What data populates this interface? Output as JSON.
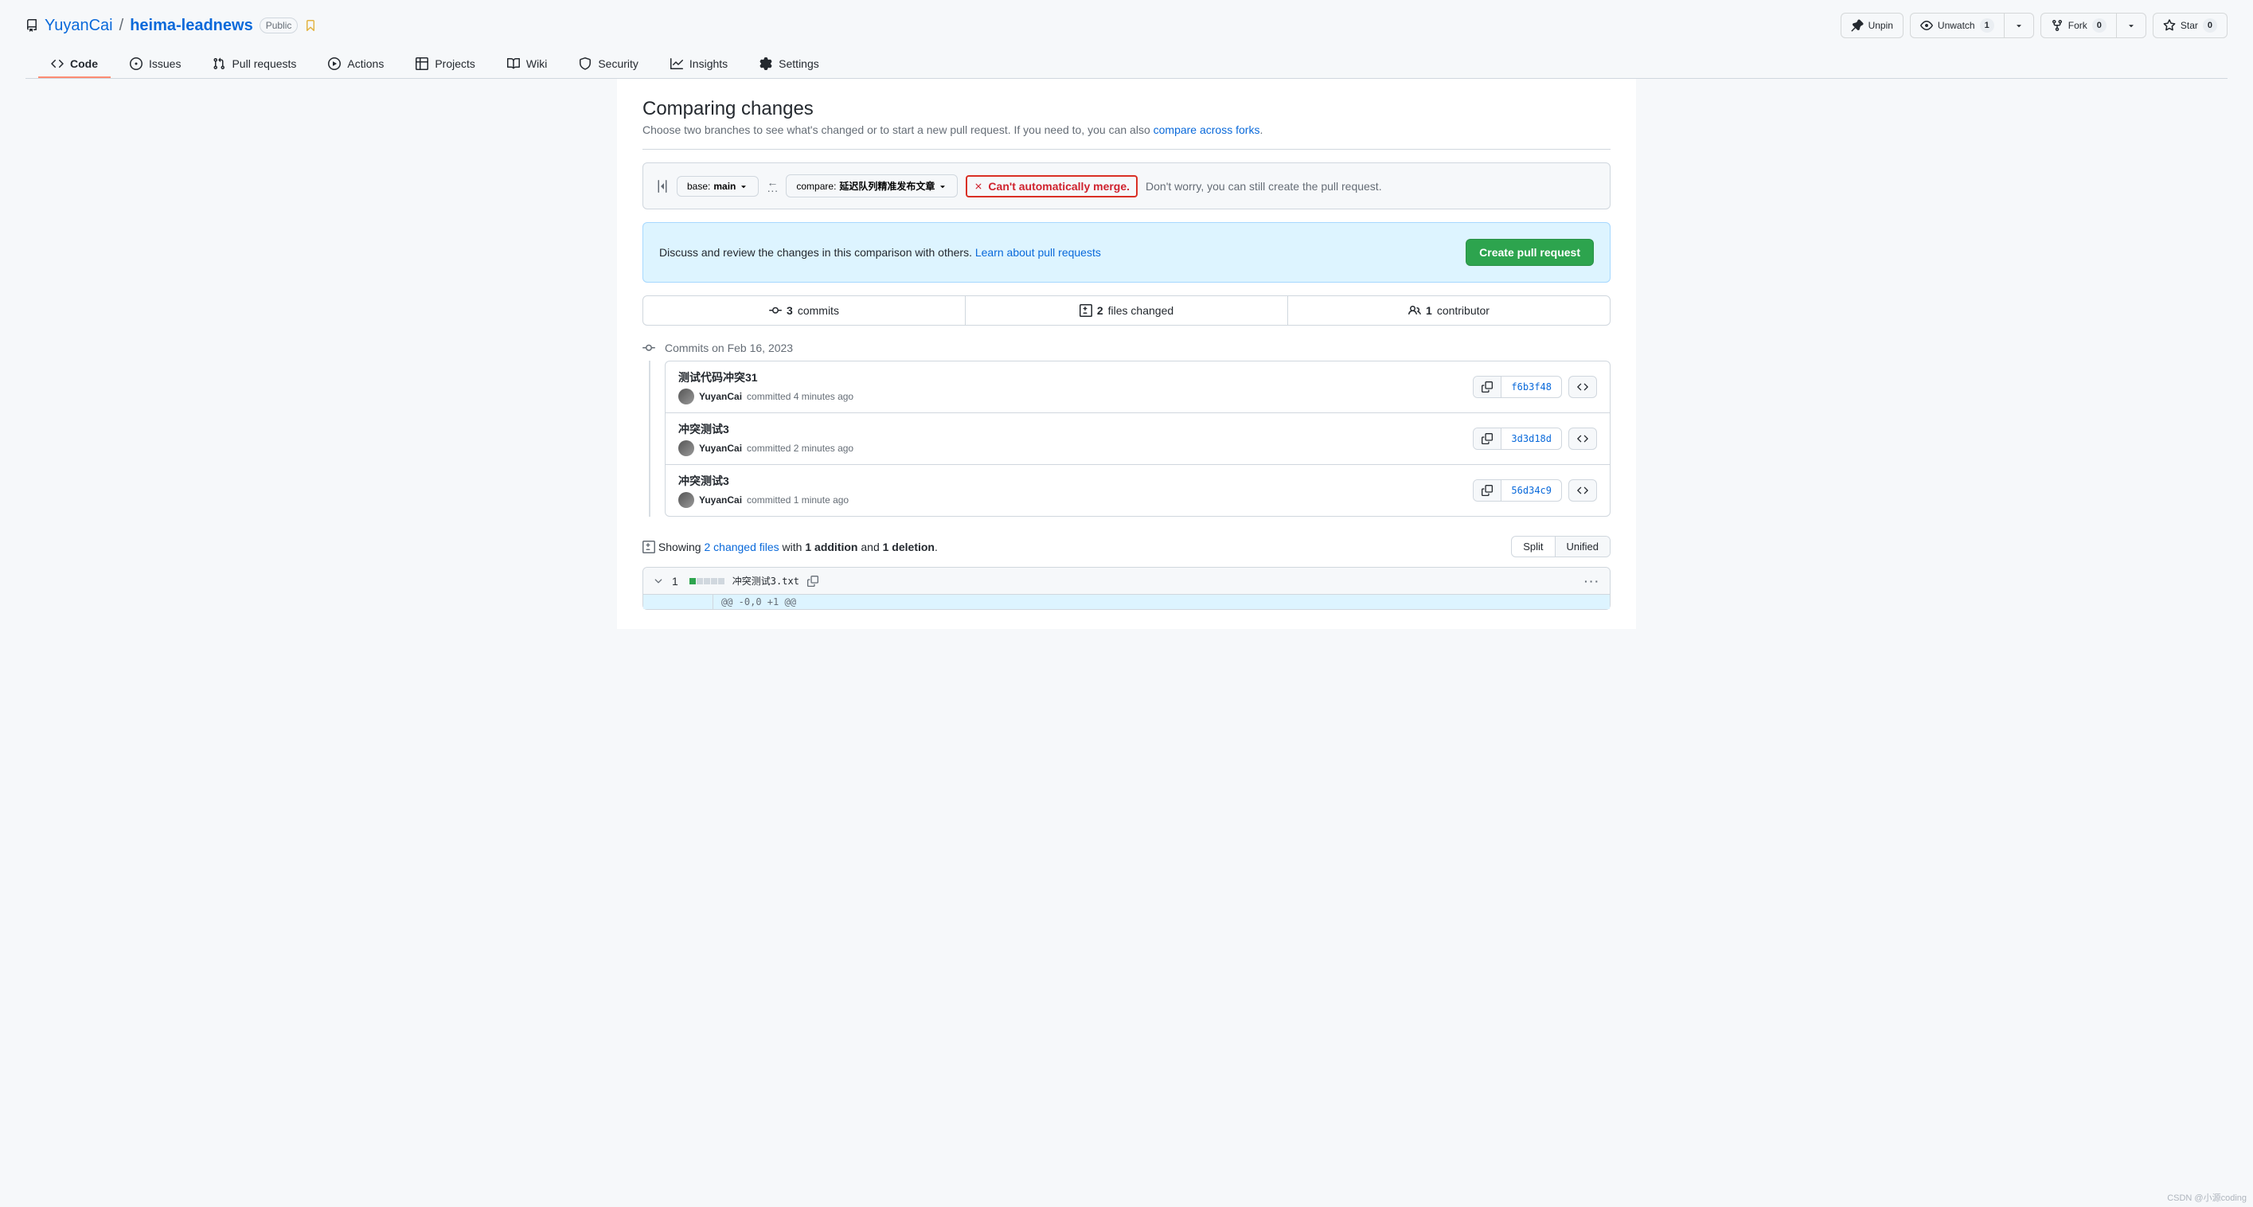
{
  "repo": {
    "owner": "YuyanCai",
    "name": "heima-leadnews",
    "visibility": "Public"
  },
  "headerActions": {
    "unpin": "Unpin",
    "unwatch": "Unwatch",
    "unwatch_count": "1",
    "fork": "Fork",
    "fork_count": "0",
    "star": "Star",
    "star_count": "0"
  },
  "nav": {
    "code": "Code",
    "issues": "Issues",
    "pulls": "Pull requests",
    "actions": "Actions",
    "projects": "Projects",
    "wiki": "Wiki",
    "security": "Security",
    "insights": "Insights",
    "settings": "Settings"
  },
  "page": {
    "title": "Comparing changes",
    "sub_prefix": "Choose two branches to see what's changed or to start a new pull request. If you need to, you can also ",
    "sub_link": "compare across forks",
    "sub_suffix": "."
  },
  "range": {
    "base_label": "base: ",
    "base_value": "main",
    "compare_label": "compare: ",
    "compare_value": "延迟队列精准发布文章",
    "conflict": "Can't automatically merge.",
    "conflict_after": " Don't worry, you can still create the pull request."
  },
  "banner": {
    "text": "Discuss and review the changes in this comparison with others. ",
    "link": "Learn about pull requests",
    "button": "Create pull request"
  },
  "stats": {
    "commits_count": "3",
    "commits_label": " commits",
    "files_count": "2",
    "files_label": " files changed",
    "contrib_count": "1",
    "contrib_label": " contributor"
  },
  "commits": {
    "date_label": "Commits on Feb 16, 2023",
    "list": [
      {
        "title": "测试代码冲突31",
        "author": "YuyanCai",
        "meta": " committed 4 minutes ago",
        "sha": "f6b3f48"
      },
      {
        "title": "冲突测试3",
        "author": "YuyanCai",
        "meta": " committed 2 minutes ago",
        "sha": "3d3d18d"
      },
      {
        "title": "冲突测试3",
        "author": "YuyanCai",
        "meta": " committed 1 minute ago",
        "sha": "56d34c9"
      }
    ]
  },
  "diff": {
    "showing_prefix": "Showing ",
    "files_link": "2 changed files",
    "with": " with ",
    "add_count": "1",
    "add_word": " addition",
    "and": " and ",
    "del_count": "1",
    "del_word": " deletion",
    "period": ".",
    "split": "Split",
    "unified": "Unified"
  },
  "file": {
    "changes": "1",
    "name": "冲突测试3.txt",
    "hunk": "@@ -0,0 +1 @@"
  },
  "watermark": "CSDN @小源coding"
}
